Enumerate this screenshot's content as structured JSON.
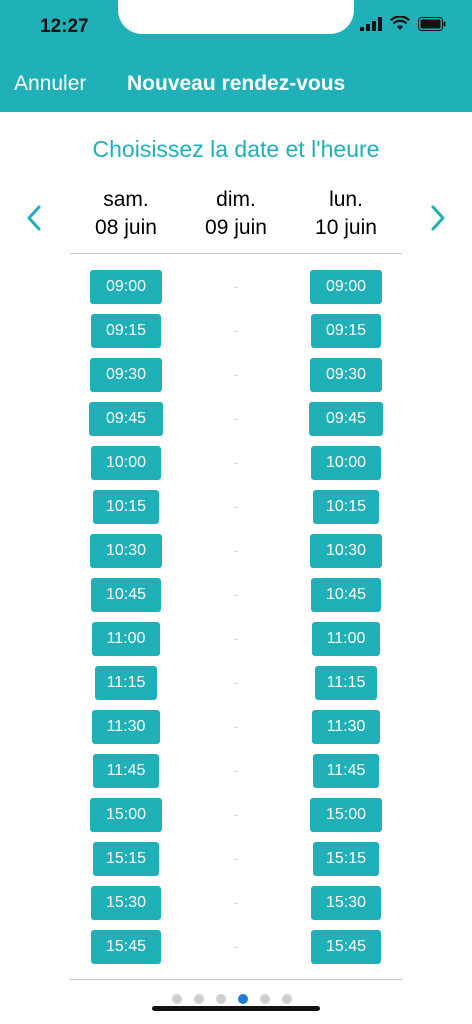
{
  "status": {
    "time": "12:27"
  },
  "nav": {
    "cancel_label": "Annuler",
    "title": "Nouveau rendez-vous"
  },
  "section_title": "Choisissez la date et l'heure",
  "days": [
    {
      "name": "sam.",
      "date": "08 juin"
    },
    {
      "name": "dim.",
      "date": "09 juin"
    },
    {
      "name": "lun.",
      "date": "10 juin"
    }
  ],
  "slots": {
    "sat": [
      "09:00",
      "09:15",
      "09:30",
      "09:45",
      "10:00",
      "10:15",
      "10:30",
      "10:45",
      "11:00",
      "11:15",
      "11:30",
      "11:45",
      "15:00",
      "15:15",
      "15:30",
      "15:45"
    ],
    "sun": [
      "-",
      "-",
      "-",
      "-",
      "-",
      "-",
      "-",
      "-",
      "-",
      "-",
      "-",
      "-",
      "-",
      "-",
      "-",
      "-"
    ],
    "mon": [
      "09:00",
      "09:15",
      "09:30",
      "09:45",
      "10:00",
      "10:15",
      "10:30",
      "10:45",
      "11:00",
      "11:15",
      "11:30",
      "11:45",
      "15:00",
      "15:15",
      "15:30",
      "15:45"
    ]
  },
  "pagination": {
    "count": 6,
    "active_index": 3
  },
  "colors": {
    "accent": "#1fb0b8",
    "active_dot": "#1e7cd6",
    "divider": "#c8c8c8"
  }
}
